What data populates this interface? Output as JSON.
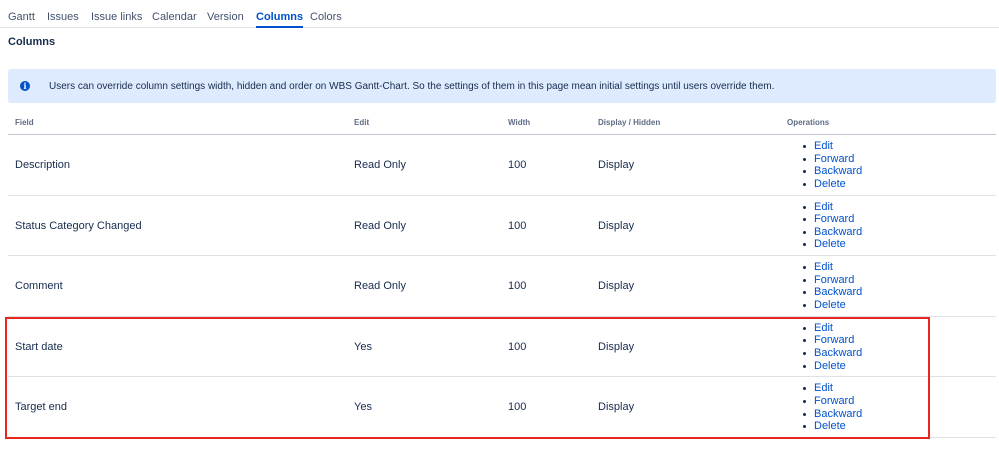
{
  "tabs": [
    {
      "label": "Gantt",
      "active": false
    },
    {
      "label": "Issues",
      "active": false
    },
    {
      "label": "Issue links",
      "active": false
    },
    {
      "label": "Calendar",
      "active": false
    },
    {
      "label": "Version",
      "active": false
    },
    {
      "label": "Columns",
      "active": true
    },
    {
      "label": "Colors",
      "active": false
    }
  ],
  "section_title": "Columns",
  "info": {
    "icon": "info-icon",
    "text": "Users can override column settings width, hidden and order on WBS Gantt-Chart. So the settings of them in this page mean initial settings until users override them."
  },
  "table": {
    "headers": {
      "field": "Field",
      "edit": "Edit",
      "width": "Width",
      "display": "Display / Hidden",
      "operations": "Operations"
    },
    "operations": [
      "Edit",
      "Forward",
      "Backward",
      "Delete"
    ],
    "rows": [
      {
        "field": "Description",
        "edit": "Read Only",
        "width": "100",
        "display": "Display"
      },
      {
        "field": "Status Category Changed",
        "edit": "Read Only",
        "width": "100",
        "display": "Display"
      },
      {
        "field": "Comment",
        "edit": "Read Only",
        "width": "100",
        "display": "Display"
      },
      {
        "field": "Start date",
        "edit": "Yes",
        "width": "100",
        "display": "Display"
      },
      {
        "field": "Target end",
        "edit": "Yes",
        "width": "100",
        "display": "Display"
      }
    ]
  },
  "colors": {
    "link": "#0052cc",
    "banner_bg": "#deebff",
    "highlight_border": "#e8251f"
  }
}
